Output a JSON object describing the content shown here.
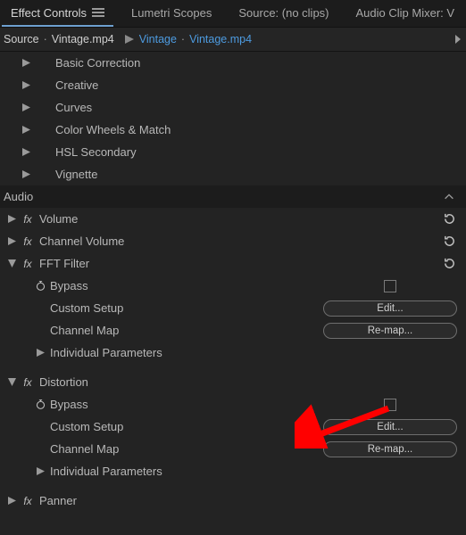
{
  "tabs": {
    "effect_controls": "Effect Controls",
    "lumetri_scopes": "Lumetri Scopes",
    "source": "Source: (no clips)",
    "audio_mixer": "Audio Clip Mixer: V"
  },
  "breadcrumb": {
    "source_prefix": "Source",
    "dot": "·",
    "source_clip": "Vintage.mp4",
    "sequence": "Vintage",
    "sequence_clip": "Vintage.mp4"
  },
  "lumetri": {
    "basic_correction": "Basic Correction",
    "creative": "Creative",
    "curves": "Curves",
    "color_wheels": "Color Wheels & Match",
    "hsl_secondary": "HSL Secondary",
    "vignette": "Vignette"
  },
  "sections": {
    "audio": "Audio"
  },
  "effects": {
    "volume": "Volume",
    "channel_volume": "Channel Volume",
    "fft_filter": "FFT Filter",
    "distortion": "Distortion",
    "panner": "Panner"
  },
  "props": {
    "bypass": "Bypass",
    "custom_setup": "Custom Setup",
    "channel_map": "Channel Map",
    "individual_parameters": "Individual Parameters",
    "edit_btn": "Edit...",
    "remap_btn": "Re-map..."
  }
}
